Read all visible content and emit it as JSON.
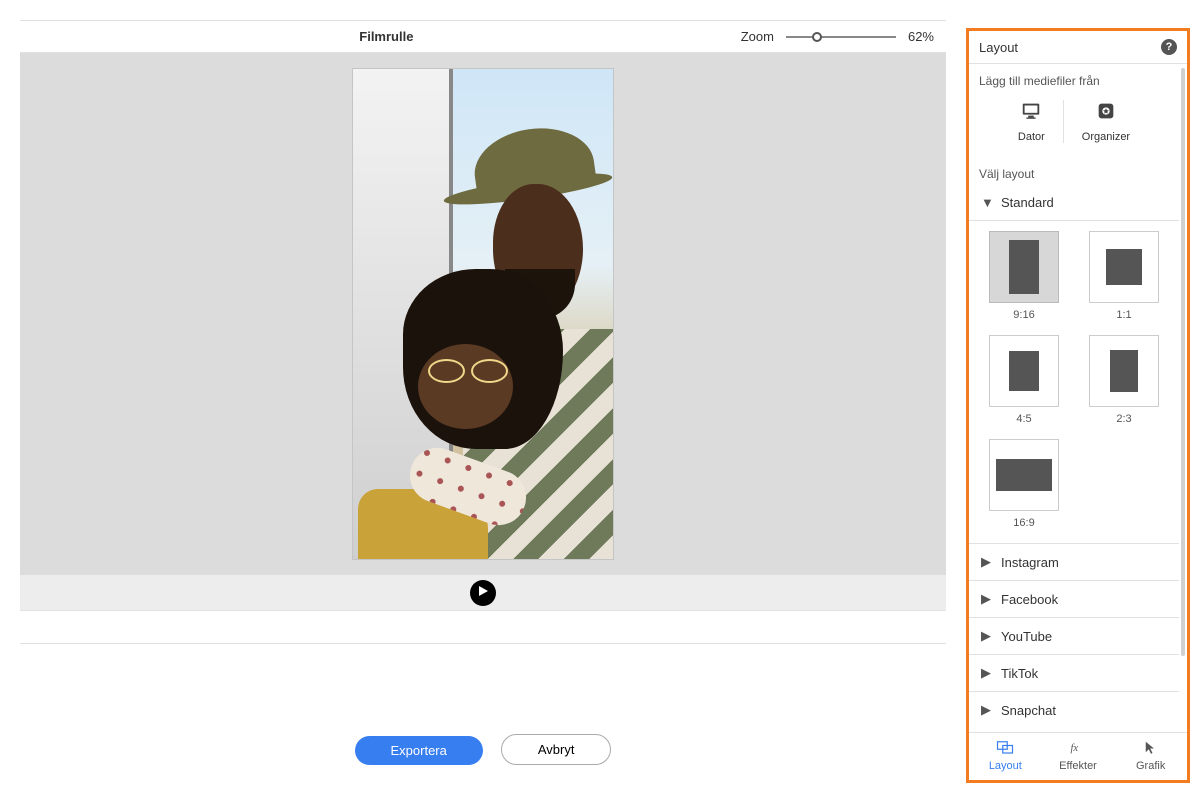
{
  "topbar": {
    "title": "Filmrulle",
    "zoom_label": "Zoom",
    "zoom_value": "62%"
  },
  "play_button": "play-icon",
  "buttons": {
    "export_label": "Exportera",
    "cancel_label": "Avbryt"
  },
  "right_panel": {
    "title": "Layout",
    "help_glyph": "?",
    "add_media_label": "Lägg till mediefiler från",
    "media_sources": [
      {
        "id": "dator",
        "label": "Dator",
        "icon": "computer-icon"
      },
      {
        "id": "organizer",
        "label": "Organizer",
        "icon": "organizer-icon"
      }
    ],
    "choose_layout_label": "Välj layout",
    "groups": [
      {
        "name": "Standard",
        "expanded": true,
        "layouts": [
          {
            "ratio": "9:16",
            "w": 30,
            "h": 54,
            "selected": true
          },
          {
            "ratio": "1:1",
            "w": 36,
            "h": 36,
            "selected": false
          },
          {
            "ratio": "4:5",
            "w": 30,
            "h": 40,
            "selected": false
          },
          {
            "ratio": "2:3",
            "w": 28,
            "h": 42,
            "selected": false
          },
          {
            "ratio": "16:9",
            "w": 56,
            "h": 32,
            "selected": false
          }
        ]
      },
      {
        "name": "Instagram",
        "expanded": false
      },
      {
        "name": "Facebook",
        "expanded": false
      },
      {
        "name": "YouTube",
        "expanded": false
      },
      {
        "name": "TikTok",
        "expanded": false
      },
      {
        "name": "Snapchat",
        "expanded": false
      }
    ],
    "tabs": [
      {
        "id": "layout",
        "label": "Layout",
        "icon": "layout-icon",
        "active": true
      },
      {
        "id": "effekter",
        "label": "Effekter",
        "icon": "fx-icon",
        "active": false
      },
      {
        "id": "grafik",
        "label": "Grafik",
        "icon": "cursor-icon",
        "active": false
      }
    ]
  },
  "colors": {
    "accent_orange": "#f47c20",
    "primary_blue": "#377ef0"
  }
}
